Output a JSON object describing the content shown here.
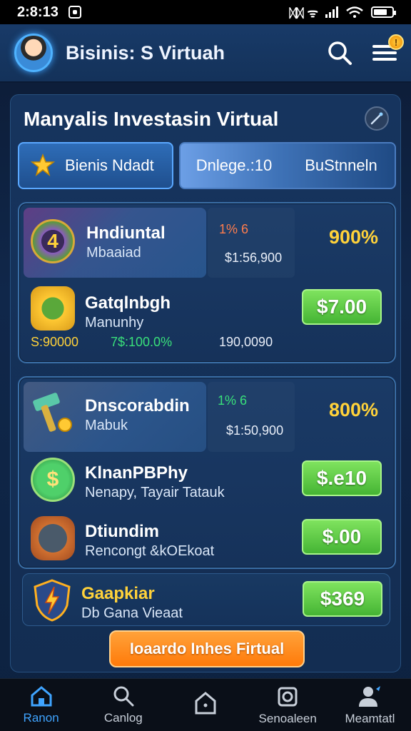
{
  "status": {
    "time": "2:8:13",
    "network": "ᛞᛞ ᯤ"
  },
  "header": {
    "title": "Bisinis: S Virtuah",
    "badge": "!"
  },
  "panel": {
    "title": "Manyalis Investasin Virtual",
    "tabs": {
      "left_label": "Bienis Ndadt",
      "right_label_1": "Dnlege.:10",
      "right_label_2": "BuStnneln"
    }
  },
  "card1": {
    "top": {
      "name": "Hndiuntal",
      "sub": "Mbaaiad",
      "tag": "1% 6",
      "price": "$1:56,900",
      "percent": "900%",
      "badge": "4"
    },
    "row": {
      "name": "Gatqlnbgh",
      "sub": "Manunhy",
      "button": "$7.00"
    },
    "stats": {
      "left": "S:90000",
      "mid": "7$:100.0%",
      "right": "190,0090"
    }
  },
  "card2": {
    "top": {
      "name": "Dnscorabdin",
      "sub": "Mabuk",
      "tag": "1% 6",
      "price": "$1:50,900",
      "percent": "800%"
    },
    "row1": {
      "name": "KlnanPBPhy",
      "sub": "Nenapy, Tayair Tatauk",
      "button": "$.e10"
    },
    "row2": {
      "name": "Dtiundim",
      "sub": "Rencongt &kOEkoat",
      "button": "$.00"
    }
  },
  "subcard": {
    "name": "Gaapkiar",
    "sub": "Db Gana Vieaat",
    "button": "$369"
  },
  "cta": {
    "label": "Ioaardo Inhes Firtual"
  },
  "nav": [
    {
      "label": "Ranon",
      "icon": "home-icon",
      "active": true
    },
    {
      "label": "Canlog",
      "icon": "search-icon",
      "active": false
    },
    {
      "label": "",
      "icon": "house-icon",
      "active": false
    },
    {
      "label": "Senoaleen",
      "icon": "camera-icon",
      "active": false
    },
    {
      "label": "Meamtatl",
      "icon": "user-icon",
      "active": false
    }
  ],
  "colors": {
    "accent": "#3fa4ff",
    "gold": "#ffd23a",
    "green": "#45b434",
    "orange": "#ff7a0a"
  }
}
